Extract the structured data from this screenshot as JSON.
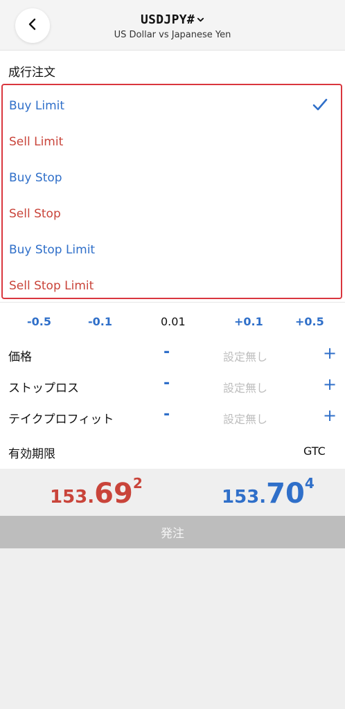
{
  "header": {
    "symbol": "USDJPY#",
    "subtitle": "US Dollar vs Japanese Yen"
  },
  "order_section_title": "成行注文",
  "order_types": [
    {
      "label": "Buy Limit",
      "side": "buy",
      "selected": true
    },
    {
      "label": "Sell Limit",
      "side": "sell",
      "selected": false
    },
    {
      "label": "Buy Stop",
      "side": "buy",
      "selected": false
    },
    {
      "label": "Sell Stop",
      "side": "sell",
      "selected": false
    },
    {
      "label": "Buy Stop Limit",
      "side": "buy",
      "selected": false
    },
    {
      "label": "Sell Stop Limit",
      "side": "sell",
      "selected": false
    }
  ],
  "volume": {
    "steps": [
      "-0.5",
      "-0.1",
      "+0.1",
      "+0.5"
    ],
    "value": "0.01"
  },
  "fields": [
    {
      "label": "価格",
      "placeholder": "設定無し",
      "minus": "-",
      "plus": "+"
    },
    {
      "label": "ストップロス",
      "placeholder": "設定無し",
      "minus": "-",
      "plus": "+"
    },
    {
      "label": "テイクプロフィット",
      "placeholder": "設定無し",
      "minus": "-",
      "plus": "+"
    }
  ],
  "expiry": {
    "label": "有効期限",
    "value": "GTC"
  },
  "prices": {
    "bid": {
      "small": "153.",
      "big": "69",
      "sup": "2"
    },
    "ask": {
      "small": "153.",
      "big": "70",
      "sup": "4"
    }
  },
  "submit_label": "発注",
  "colors": {
    "buy": "#2f6fc9",
    "sell": "#c9443a",
    "highlight_border": "#d9363e"
  }
}
